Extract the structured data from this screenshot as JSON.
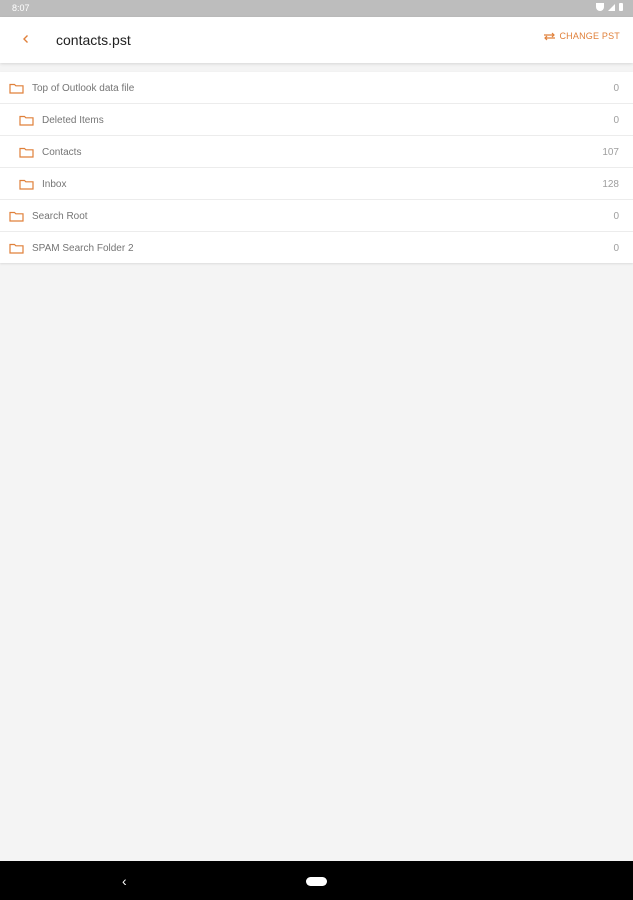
{
  "status_bar": {
    "time": "8:07"
  },
  "app_bar": {
    "title": "contacts.pst",
    "change_label": "CHANGE PST",
    "accent": "#e0803a"
  },
  "folders": [
    {
      "name": "Top of Outlook data file",
      "count": "0",
      "level": 0,
      "icon": "folder-icon"
    },
    {
      "name": "Deleted Items",
      "count": "0",
      "level": 1,
      "icon": "folder-icon"
    },
    {
      "name": "Contacts",
      "count": "107",
      "level": 1,
      "icon": "folder-icon"
    },
    {
      "name": "Inbox",
      "count": "128",
      "level": 1,
      "icon": "folder-icon"
    },
    {
      "name": "Search Root",
      "count": "0",
      "level": 0,
      "icon": "folder-icon"
    },
    {
      "name": "SPAM Search Folder 2",
      "count": "0",
      "level": 0,
      "icon": "folder-icon"
    }
  ],
  "nav_bar": {
    "back_icon": "back-icon",
    "home_icon": "home-pill-icon"
  }
}
